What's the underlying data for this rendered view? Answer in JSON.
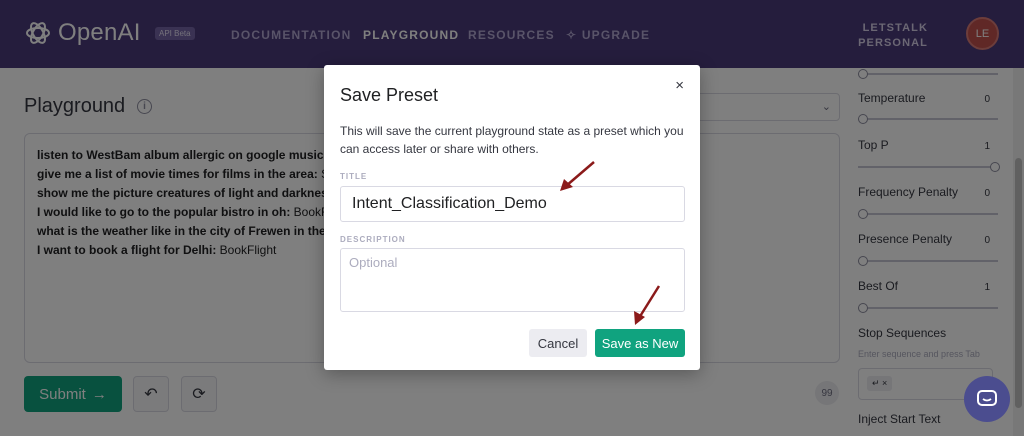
{
  "header": {
    "logo_text": "OpenAI",
    "beta_badge": "API Beta",
    "nav": [
      "DOCUMENTATION",
      "PLAYGROUND",
      "RESOURCES",
      "UPGRADE"
    ],
    "account_line1": "LETSTALK",
    "account_line2": "PERSONAL",
    "avatar_initials": "LE"
  },
  "page": {
    "title": "Playground",
    "token_count": "99",
    "submit_label": "Submit",
    "editor_lines": [
      {
        "prompt": "listen to WestBam album allergic on google music:",
        "completion": ""
      },
      {
        "prompt": "give me a list of movie times for films in the area:",
        "completion": " Se"
      },
      {
        "prompt": "show me the picture creatures of light and darkness",
        "completion": ""
      },
      {
        "prompt": "I would like to go to the popular bistro in oh:",
        "completion": " BookR"
      },
      {
        "prompt": "what is the weather like in the city of Frewen in the",
        "completion": ""
      },
      {
        "prompt": "I want to book a flight for Delhi:",
        "completion": " BookFlight"
      }
    ]
  },
  "settings": {
    "temperature_label": "Temperature",
    "temperature_value": "0",
    "temperature_fraction": 0,
    "top_p_label": "Top P",
    "top_p_value": "1",
    "top_p_fraction": 1,
    "frequency_label": "Frequency Penalty",
    "frequency_value": "0",
    "frequency_fraction": 0,
    "presence_label": "Presence Penalty",
    "presence_value": "0",
    "presence_fraction": 0,
    "best_of_label": "Best Of",
    "best_of_value": "1",
    "best_of_fraction": 0,
    "stop_label": "Stop Sequences",
    "stop_hint": "Enter sequence and press Tab",
    "stop_chip": "↵ ×",
    "inject_label": "Inject Start Text"
  },
  "modal": {
    "title": "Save Preset",
    "close_symbol": "×",
    "description": "This will save the current playground state as a preset which you can access later or share with others.",
    "title_field_label": "TITLE",
    "title_value": "Intent_Classification_Demo",
    "description_field_label": "DESCRIPTION",
    "description_placeholder": "Optional",
    "cancel_label": "Cancel",
    "save_label": "Save as New"
  },
  "colors": {
    "nav_bg": "#4b3a7a",
    "accent_green": "#10a37f",
    "annotation_arrow": "#8b1a1a"
  }
}
